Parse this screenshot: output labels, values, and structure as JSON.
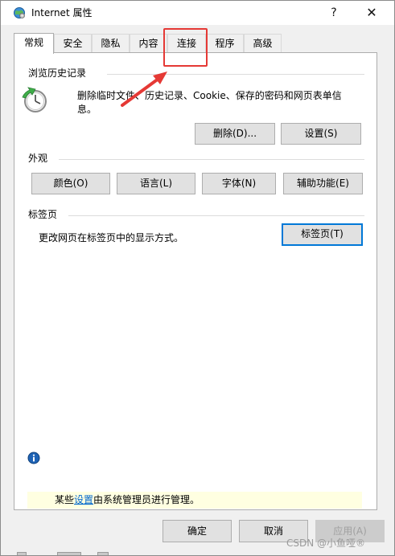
{
  "window": {
    "title": "Internet 属性",
    "help_label": "?",
    "close_label": "✕",
    "title_icon": "globe-settings-icon"
  },
  "tabs": [
    {
      "label": "常规",
      "active": true
    },
    {
      "label": "安全",
      "active": false
    },
    {
      "label": "隐私",
      "active": false
    },
    {
      "label": "内容",
      "active": false
    },
    {
      "label": "连接",
      "active": false
    },
    {
      "label": "程序",
      "active": false
    },
    {
      "label": "高级",
      "active": false
    }
  ],
  "browsing_history": {
    "title": "浏览历史记录",
    "description_line1": "删除临时文件、历史记录、Cookie、保存的密码和网页表单信",
    "description_line2": "息。",
    "delete_button": "删除(D)...",
    "settings_button": "设置(S)",
    "icon": "history-clock-icon"
  },
  "appearance": {
    "title": "外观",
    "colors_button": "颜色(O)",
    "languages_button": "语言(L)",
    "fonts_button": "字体(N)",
    "accessibility_button": "辅助功能(E)"
  },
  "tabs_group": {
    "title": "标签页",
    "description": "更改网页在标签页中的显示方式。",
    "tabs_button": "标签页(T)"
  },
  "notice": {
    "prefix": "某些",
    "link": "设置",
    "suffix": "由系统管理员进行管理。",
    "icon": "info-icon"
  },
  "footer": {
    "ok_button": "确定",
    "cancel_button": "取消",
    "apply_button": "应用(A)"
  },
  "annotation": {
    "highlight_color": "#e53935"
  },
  "watermark": {
    "text": "CSDN @小鱼哑®"
  },
  "colors": {
    "accent": "#0078d7",
    "link": "#0066cc",
    "notice_bg": "#ffffe1"
  }
}
